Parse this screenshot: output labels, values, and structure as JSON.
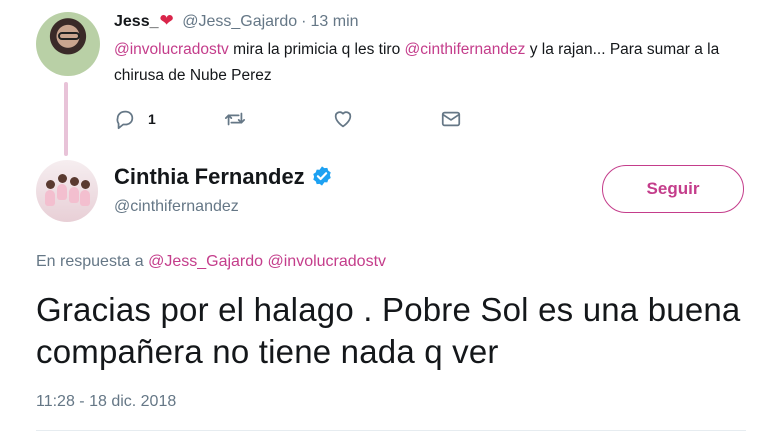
{
  "parent_tweet": {
    "display_name": "Jess_",
    "heart": "❤",
    "handle": "@Jess_Gajardo",
    "separator": "·",
    "time": "13 min",
    "text_parts": {
      "mention1": "@involucradostv",
      "t1": " mira la primicia q les tiro ",
      "mention2": "@cinthifernandez",
      "t2": " y la rajan... Para sumar a la chirusa de Nube Perez"
    },
    "reply_count": "1",
    "icons": [
      "reply-icon",
      "retweet-icon",
      "like-icon",
      "message-icon"
    ]
  },
  "main_tweet": {
    "display_name": "Cinthia Fernandez",
    "handle": "@cinthifernandez",
    "follow_label": "Seguir",
    "reply_prefix": "En respuesta a ",
    "reply_mention1": "@Jess_Gajardo",
    "reply_mention2": "@involucradostv",
    "text": "Gracias por el halago . Pobre Sol es una buena compañera no tiene nada q ver",
    "timestamp": "11:28 - 18 dic. 2018"
  },
  "colors": {
    "accent": "#c43d8b",
    "muted": "#657786",
    "verified": "#1da1f2",
    "thread_line": "#e8c3d8"
  }
}
